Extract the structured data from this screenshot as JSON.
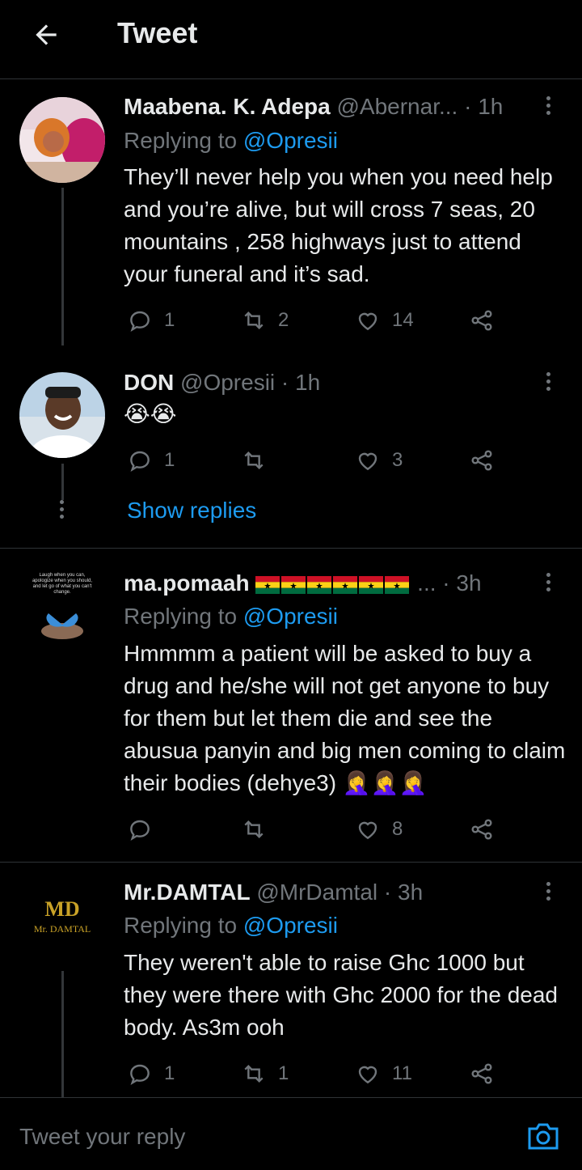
{
  "header": {
    "title": "Tweet"
  },
  "tweets": [
    {
      "name": "Maabena. K. Adepa",
      "handle": "@Abernar...",
      "time": "· 1h",
      "reply_prefix": "Replying to ",
      "reply_handle": "@Opresii",
      "text": "They’ll never help you when you need help and you’re alive, but will cross 7 seas, 20 mountains , 258 highways just to attend your funeral and it’s sad.",
      "replies": "1",
      "retweets": "2",
      "likes": "14"
    },
    {
      "name": "DON",
      "handle": "@Opresii",
      "time": "· 1h",
      "text": "😭😭",
      "replies": "1",
      "retweets": "",
      "likes": "3",
      "show_replies": "Show replies"
    },
    {
      "name": "ma.pomaah",
      "handle": "...",
      "time": "· 3h",
      "reply_prefix": "Replying to ",
      "reply_handle": "@Opresii",
      "text": "Hmmmm a patient will be asked to buy a drug and he/she will not get anyone to buy for them but let them die and see the abusua panyin and big men coming to claim their bodies (dehye3)",
      "emoji_suffix": "🤦‍♀️🤦‍♀️🤦‍♀️",
      "avatar_caption": "Laugh when you can, apologize when you should, and let go of what you can't change.",
      "replies": "",
      "retweets": "",
      "likes": "8"
    },
    {
      "name": "Mr.DAMTAL",
      "handle": "@MrDamtal",
      "time": "· 3h",
      "reply_prefix": "Replying to ",
      "reply_handle": "@Opresii",
      "text": "They weren't able to raise Ghc 1000 but they were there with Ghc 2000 for the dead body. As3m ooh",
      "avatar_logo": "MD",
      "avatar_brand": "Mr. DAMTAL",
      "replies": "1",
      "retweets": "1",
      "likes": "11"
    }
  ],
  "reply_bar": {
    "placeholder": "Tweet your reply"
  },
  "colors": {
    "accent": "#1d9bf0",
    "muted": "#71767b",
    "text": "#e7e9ea",
    "background": "#000000"
  }
}
